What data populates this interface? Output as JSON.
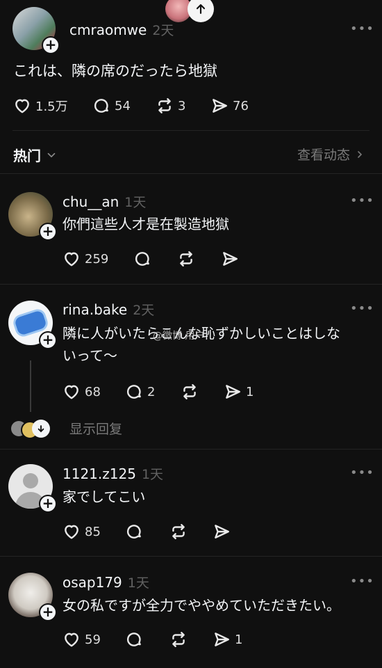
{
  "post": {
    "username": "cmraomwe",
    "time": "2天",
    "more": "•••",
    "text": "これは、隣の席のだったら地獄",
    "likes": "1.5万",
    "comments": "54",
    "reposts": "3",
    "shares": "76"
  },
  "sort": {
    "label": "热门",
    "activity_link": "查看动态"
  },
  "replies": [
    {
      "username": "chu__an",
      "time": "1天",
      "more": "•••",
      "text": "你們這些人才是在製造地獄",
      "likes": "259",
      "comments": "",
      "reposts": "",
      "shares": ""
    },
    {
      "username": "rina.bake",
      "time": "2天",
      "more": "•••",
      "text_line1": "隣に人がいたらこんな恥ずかしいことはしな",
      "text_line2": "いって〜",
      "likes": "68",
      "comments": "2",
      "reposts": "",
      "shares": "1",
      "show_replies": "显示回复"
    },
    {
      "username": "1121.z125",
      "time": "1天",
      "more": "•••",
      "text": "家でしてこい",
      "likes": "85",
      "comments": "",
      "reposts": "",
      "shares": ""
    },
    {
      "username": "osap179",
      "time": "1天",
      "more": "•••",
      "text": "女の私ですが全力でややめていただきたい。",
      "likes": "59",
      "comments": "",
      "reposts": "",
      "shares": "1"
    }
  ],
  "watermark": "@微博 用户"
}
